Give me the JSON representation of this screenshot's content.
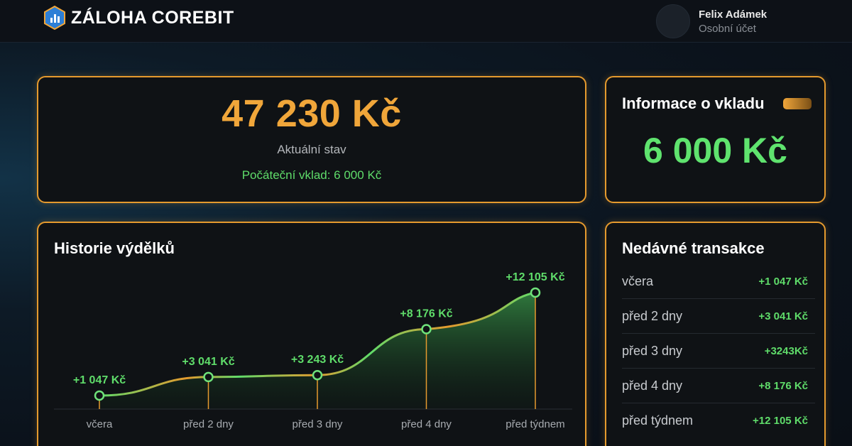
{
  "header": {
    "brand": "ZÁLOHA COREBIT",
    "user_name": "Felix Adámek",
    "user_subtitle": "Osobní účet",
    "logo_icon": "hexagon-chart-icon"
  },
  "balance": {
    "value": "47 230 Kč",
    "label": "Aktuální stav",
    "deposit_line": "Počáteční vklad: 6 000 Kč"
  },
  "deposit_info": {
    "title": "Informace o vkladu",
    "value": "6 000 Kč"
  },
  "history": {
    "title": "Historie výdělků"
  },
  "transactions": {
    "title": "Nedávné transakce",
    "items": [
      {
        "label": "včera",
        "amount": "+1 047 Kč"
      },
      {
        "label": "před 2 dny",
        "amount": "+3 041 Kč"
      },
      {
        "label": "před 3 dny",
        "amount": "+3243Kč"
      },
      {
        "label": "před 4 dny",
        "amount": "+8 176 Kč"
      },
      {
        "label": "před týdnem",
        "amount": "+12 105 Kč"
      }
    ]
  },
  "colors": {
    "accent": "#e59a2e",
    "amount_orange": "#f0a63a",
    "positive_green": "#5fdc6a"
  },
  "chart_data": {
    "type": "area",
    "title": "Historie výdělků",
    "categories": [
      "včera",
      "před 2 dny",
      "před 3 dny",
      "před 4 dny",
      "před týdnem"
    ],
    "values": [
      1047,
      3041,
      3243,
      8176,
      12105
    ],
    "data_labels": [
      "+1 047 Kč",
      "+3 041 Kč",
      "+3 243 Kč",
      "+8 176 Kč",
      "+12 105 Kč"
    ],
    "grid": false
  }
}
